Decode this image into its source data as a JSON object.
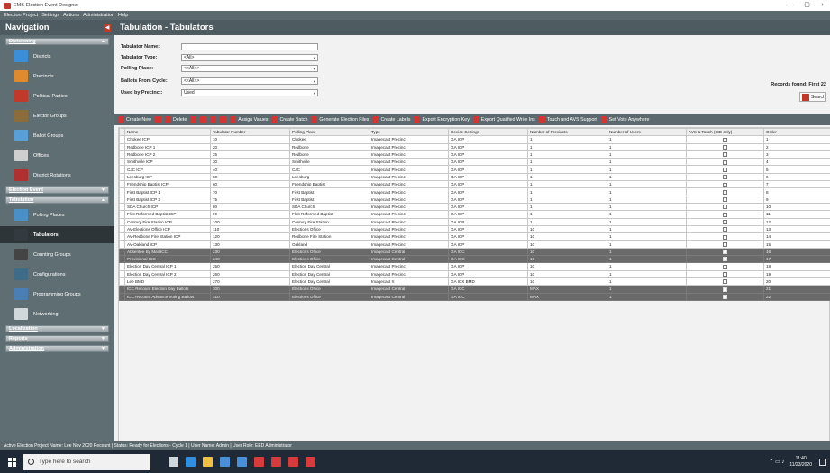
{
  "window": {
    "title": "EMS Election Event Designer",
    "controls": [
      "–",
      "▢",
      "›"
    ]
  },
  "menu": [
    "Election Project",
    "Settings",
    "Actions",
    "Administration",
    "Help"
  ],
  "navigation": {
    "title": "Navigation",
    "sections": [
      {
        "label": "Divisioning",
        "items": [
          {
            "label": "Districts",
            "icon": "districts-icon",
            "color": "#3b8fd9"
          },
          {
            "label": "Precincts",
            "icon": "precincts-icon",
            "color": "#e08a2e"
          },
          {
            "label": "Political Parties",
            "icon": "political-parties-icon",
            "color": "#c0392b"
          },
          {
            "label": "Elector Groups",
            "icon": "elector-groups-icon",
            "color": "#8a6d3b"
          },
          {
            "label": "Ballot Groups",
            "icon": "ballot-groups-icon",
            "color": "#5aa0d8"
          },
          {
            "label": "Offices",
            "icon": "offices-icon",
            "color": "#cfcfcf"
          },
          {
            "label": "District Rotations",
            "icon": "district-rotations-icon",
            "color": "#b03030"
          }
        ]
      },
      {
        "label": "Election Event",
        "items": []
      },
      {
        "label": "Tabulation",
        "items": [
          {
            "label": "Polling Places",
            "icon": "polling-places-icon",
            "color": "#4a90c8"
          },
          {
            "label": "Tabulators",
            "icon": "tabulators-icon",
            "color": "#333a40",
            "active": true
          },
          {
            "label": "Counting Groups",
            "icon": "counting-groups-icon",
            "color": "#444"
          },
          {
            "label": "Configurations",
            "icon": "configurations-icon",
            "color": "#3e6b8a"
          },
          {
            "label": "Programming Groups",
            "icon": "programming-groups-icon",
            "color": "#4a7fb5"
          },
          {
            "label": "Networking",
            "icon": "networking-icon",
            "color": "#d0d8dc"
          }
        ]
      },
      {
        "label": "Localization",
        "items": []
      },
      {
        "label": "Reports",
        "items": []
      },
      {
        "label": "Administration",
        "items": []
      }
    ]
  },
  "page": {
    "title": "Tabulation - Tabulators"
  },
  "filters": {
    "tabulator_name": {
      "label": "Tabulator Name:",
      "value": ""
    },
    "tabulator_type": {
      "label": "Tabulator Type:",
      "value": "<All>"
    },
    "polling_place": {
      "label": "Polling Place:",
      "value": "<<All>>"
    },
    "ballots_from_cycle": {
      "label": "Ballots From Cycle:",
      "value": "<<All>>"
    },
    "used_by_precinct": {
      "label": "Used by Precinct:",
      "value": "Used"
    }
  },
  "records_found": "Records found: First 22",
  "search_label": "Search",
  "toolbar": [
    {
      "label": "Create New",
      "icon": "create-new-icon"
    },
    {
      "label": "",
      "icon": "edit-icon"
    },
    {
      "label": "Delete",
      "icon": "delete-icon"
    },
    {
      "label": "",
      "icon": "move-up-icon"
    },
    {
      "label": "",
      "icon": "move-down-icon"
    },
    {
      "label": "",
      "icon": "sort-icon"
    },
    {
      "label": "",
      "icon": "save-icon"
    },
    {
      "label": "Assign Values",
      "icon": "assign-values-icon"
    },
    {
      "label": "Create Batch",
      "icon": "create-batch-icon"
    },
    {
      "label": "Generate Election Files",
      "icon": "generate-election-files-icon"
    },
    {
      "label": "Create Labels",
      "icon": "create-labels-icon"
    },
    {
      "label": "Export Encryption Key",
      "icon": "export-encryption-key-icon"
    },
    {
      "label": "Export Qualified Write Ins",
      "icon": "export-write-ins-icon"
    },
    {
      "label": "Touch and AVS Support",
      "icon": "touch-avs-support-icon"
    },
    {
      "label": "Set Vote Anywhere",
      "icon": "set-vote-anywhere-icon"
    }
  ],
  "table": {
    "columns": [
      "Name",
      "Tabulator Number",
      "Polling Place",
      "Type",
      "Device Settings",
      "Number of Precincts",
      "Number of Users",
      "AVS & Touch (ICE only)",
      "Order"
    ],
    "rows": [
      {
        "cells": [
          "Chokee ICP",
          "10",
          "Chokee",
          "Imagecast Precinct",
          "GA ICP",
          "1",
          "1",
          "",
          "1"
        ],
        "dark": false
      },
      {
        "cells": [
          "Redbone ICP 1",
          "20",
          "Redbone",
          "Imagecast Precinct",
          "GA ICP",
          "1",
          "1",
          "",
          "2"
        ],
        "dark": false
      },
      {
        "cells": [
          "Redbone ICP 2",
          "25",
          "Redbone",
          "Imagecast Precinct",
          "GA ICP",
          "1",
          "1",
          "",
          "3"
        ],
        "dark": false
      },
      {
        "cells": [
          "Smithville ICP",
          "30",
          "Smithville",
          "Imagecast Precinct",
          "GA ICP",
          "1",
          "1",
          "",
          "4"
        ],
        "dark": false
      },
      {
        "cells": [
          "CJC ICP",
          "40",
          "CJC",
          "Imagecast Precinct",
          "GA ICP",
          "1",
          "1",
          "",
          "5"
        ],
        "dark": false
      },
      {
        "cells": [
          "Leesburg ICP",
          "50",
          "Leesburg",
          "Imagecast Precinct",
          "GA ICP",
          "1",
          "1",
          "",
          "6"
        ],
        "dark": false
      },
      {
        "cells": [
          "Friendship Baptist ICP",
          "60",
          "Friendship Baptist",
          "Imagecast Precinct",
          "GA ICP",
          "1",
          "1",
          "",
          "7"
        ],
        "dark": false
      },
      {
        "cells": [
          "First Baptist ICP 1",
          "70",
          "First Baptist",
          "Imagecast Precinct",
          "GA ICP",
          "1",
          "1",
          "",
          "8"
        ],
        "dark": false
      },
      {
        "cells": [
          "First Baptist ICP 2",
          "75",
          "First Baptist",
          "Imagecast Precinct",
          "GA ICP",
          "1",
          "1",
          "",
          "9"
        ],
        "dark": false
      },
      {
        "cells": [
          "SDA Church ICP",
          "80",
          "SDA Church",
          "Imagecast Precinct",
          "GA ICP",
          "1",
          "1",
          "",
          "10"
        ],
        "dark": false
      },
      {
        "cells": [
          "Flint Reformed Baptist ICP",
          "90",
          "Flint Reformed Baptist",
          "Imagecast Precinct",
          "GA ICP",
          "1",
          "1",
          "",
          "11"
        ],
        "dark": false
      },
      {
        "cells": [
          "Century Fire Station ICP",
          "100",
          "Century Fire Station",
          "Imagecast Precinct",
          "GA ICP",
          "1",
          "1",
          "",
          "12"
        ],
        "dark": false
      },
      {
        "cells": [
          "AV-Elections Office ICP",
          "110",
          "Elections Office",
          "Imagecast Precinct",
          "GA ICP",
          "10",
          "1",
          "",
          "13"
        ],
        "dark": false
      },
      {
        "cells": [
          "AV-Redbone Fire Station ICP",
          "120",
          "Redbone Fire Station",
          "Imagecast Precinct",
          "GA ICP",
          "10",
          "1",
          "",
          "14"
        ],
        "dark": false
      },
      {
        "cells": [
          "AV-Oakland ICP",
          "130",
          "Oakland",
          "Imagecast Precinct",
          "GA ICP",
          "10",
          "1",
          "",
          "15"
        ],
        "dark": false
      },
      {
        "cells": [
          "Absentee By Mail ICC",
          "230",
          "Elections Office",
          "Imagecast Central",
          "GA ICC",
          "10",
          "1",
          "",
          "16"
        ],
        "dark": true
      },
      {
        "cells": [
          "Provisional ICC",
          "240",
          "Elections Office",
          "Imagecast Central",
          "GA ICC",
          "10",
          "1",
          "",
          "17"
        ],
        "dark": true
      },
      {
        "cells": [
          "Election Day Central ICP 1",
          "250",
          "Election Day Central",
          "Imagecast Precinct",
          "GA ICP",
          "10",
          "1",
          "",
          "18"
        ],
        "dark": false
      },
      {
        "cells": [
          "Election Day Central ICP 2",
          "260",
          "Election Day Central",
          "Imagecast Precinct",
          "GA ICP",
          "10",
          "1",
          "",
          "19"
        ],
        "dark": false
      },
      {
        "cells": [
          "Lee BMD",
          "270",
          "Election Day Central",
          "Imagecast X",
          "GA ICX BMD",
          "10",
          "1",
          "",
          "20"
        ],
        "dark": false
      },
      {
        "cells": [
          "ICC Recount Election Day Ballots",
          "300",
          "Elections Office",
          "Imagecast Central",
          "GA ICC",
          "MAX",
          "1",
          "",
          "21"
        ],
        "dark": true
      },
      {
        "cells": [
          "ICC Recount Advance Voting Ballots",
          "310",
          "Elections Office",
          "Imagecast Central",
          "GA ICC",
          "MAX",
          "1",
          "",
          "22"
        ],
        "dark": true
      }
    ]
  },
  "statusbar": "Active Election Project Name: Lee Nov 2020 Recount | Status: Ready for Elections - Cycle 1 | User Name: Admin | User Role: EED Administrator",
  "taskbar": {
    "search_placeholder": "Type here to search",
    "time": "11:40",
    "date": "11/23/2020",
    "apps": [
      "task-view-icon",
      "edge-icon",
      "file-explorer-icon",
      "store-icon",
      "mail-icon",
      "app1-icon",
      "app2-icon",
      "app3-icon",
      "app4-icon"
    ],
    "app_colors": [
      "#cfd6dc",
      "#2f8fe0",
      "#f0c040",
      "#4a90d8",
      "#4a90d8",
      "#d83b3b",
      "#d83b3b",
      "#d83b3b",
      "#d83b3b"
    ]
  },
  "colors": {
    "nav_bg": "#5f6e73",
    "header_bg": "#4e5b60",
    "accent": "#d63333",
    "dark_row": "#6a6a6a"
  }
}
